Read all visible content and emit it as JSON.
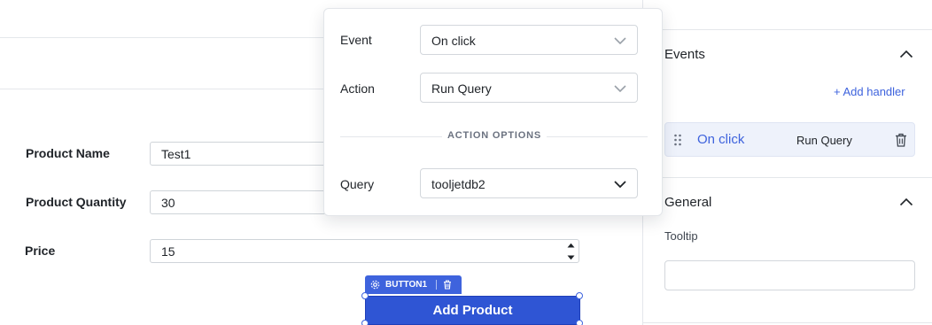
{
  "form": {
    "product_name": {
      "label": "Product Name",
      "value": "Test1"
    },
    "product_quantity": {
      "label": "Product Quantity",
      "value": "30"
    },
    "price": {
      "label": "Price",
      "value": "15"
    }
  },
  "widget": {
    "tag_label": "BUTTON1",
    "button_label": "Add Product"
  },
  "popover": {
    "event_label": "Event",
    "event_value": "On click",
    "action_label": "Action",
    "action_value": "Run Query",
    "options_heading": "ACTION OPTIONS",
    "query_label": "Query",
    "query_value": "tooljetdb2"
  },
  "inspector": {
    "events_title": "Events",
    "add_handler": "+ Add handler",
    "handlers": [
      {
        "event": "On click",
        "action": "Run Query"
      }
    ],
    "general_title": "General",
    "tooltip_label": "Tooltip",
    "tooltip_value": ""
  },
  "colors": {
    "accent": "#3e63dd",
    "button_bg": "#2f55d4",
    "handler_row_bg": "#eef2fb"
  }
}
